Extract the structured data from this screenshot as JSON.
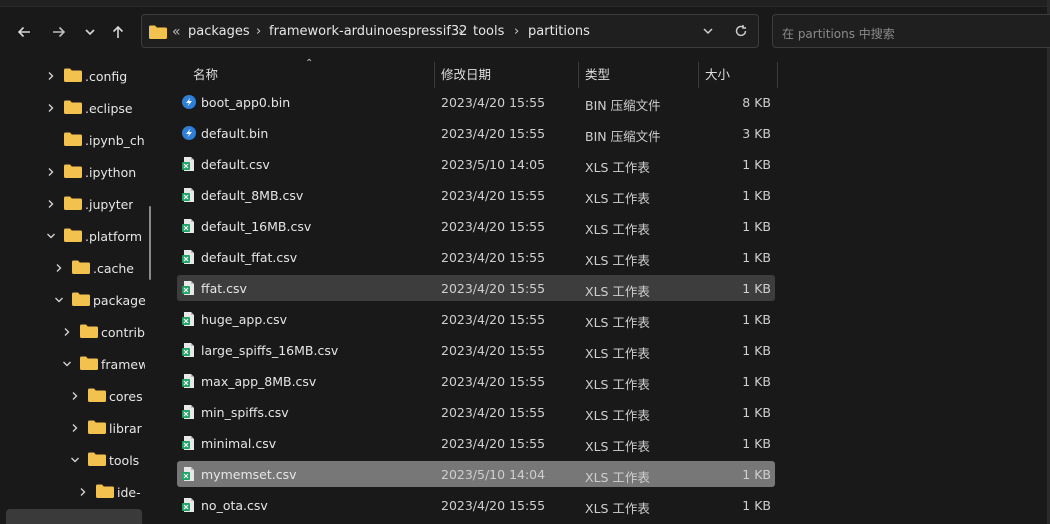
{
  "toolbar": {
    "back_icon": "arrow-left-icon",
    "forward_icon": "arrow-right-icon",
    "recent_icon": "chevron-down-icon",
    "up_icon": "arrow-up-icon"
  },
  "address": {
    "overflow": "«",
    "segments": [
      "packages",
      "framework-arduinoespressif32",
      "tools",
      "partitions"
    ]
  },
  "search": {
    "placeholder": "在 partitions 中搜索"
  },
  "tree": {
    "items": [
      {
        "label": ".config",
        "expanded": false,
        "has_children": true
      },
      {
        "label": ".eclipse",
        "expanded": false,
        "has_children": true
      },
      {
        "label": ".ipynb_ch",
        "expanded": false,
        "has_children": false
      },
      {
        "label": ".ipython",
        "expanded": false,
        "has_children": true
      },
      {
        "label": ".jupyter",
        "expanded": false,
        "has_children": true
      },
      {
        "label": ".platform",
        "expanded": true,
        "has_children": true
      },
      {
        "label": ".cache",
        "expanded": false,
        "has_children": true
      },
      {
        "label": "package",
        "expanded": true,
        "has_children": true
      },
      {
        "label": "contrib",
        "expanded": false,
        "has_children": true
      },
      {
        "label": "framew",
        "expanded": true,
        "has_children": true
      },
      {
        "label": "cores",
        "expanded": false,
        "has_children": true
      },
      {
        "label": "librar",
        "expanded": false,
        "has_children": true
      },
      {
        "label": "tools",
        "expanded": true,
        "has_children": true
      },
      {
        "label": "ide-",
        "expanded": false,
        "has_children": true
      }
    ]
  },
  "columns": {
    "name": "名称",
    "date": "修改日期",
    "type": "类型",
    "size": "大小"
  },
  "files": [
    {
      "name": "boot_app0.bin",
      "date": "2023/4/20 15:55",
      "type": "BIN 压缩文件",
      "size": "8 KB",
      "icon": "bin-file-icon",
      "state": ""
    },
    {
      "name": "default.bin",
      "date": "2023/4/20 15:55",
      "type": "BIN 压缩文件",
      "size": "3 KB",
      "icon": "bin-file-icon",
      "state": ""
    },
    {
      "name": "default.csv",
      "date": "2023/5/10 14:05",
      "type": "XLS 工作表",
      "size": "1 KB",
      "icon": "csv-file-icon",
      "state": ""
    },
    {
      "name": "default_8MB.csv",
      "date": "2023/4/20 15:55",
      "type": "XLS 工作表",
      "size": "1 KB",
      "icon": "csv-file-icon",
      "state": ""
    },
    {
      "name": "default_16MB.csv",
      "date": "2023/4/20 15:55",
      "type": "XLS 工作表",
      "size": "1 KB",
      "icon": "csv-file-icon",
      "state": ""
    },
    {
      "name": "default_ffat.csv",
      "date": "2023/4/20 15:55",
      "type": "XLS 工作表",
      "size": "1 KB",
      "icon": "csv-file-icon",
      "state": ""
    },
    {
      "name": "ffat.csv",
      "date": "2023/4/20 15:55",
      "type": "XLS 工作表",
      "size": "1 KB",
      "icon": "csv-file-icon",
      "state": "hover"
    },
    {
      "name": "huge_app.csv",
      "date": "2023/4/20 15:55",
      "type": "XLS 工作表",
      "size": "1 KB",
      "icon": "csv-file-icon",
      "state": ""
    },
    {
      "name": "large_spiffs_16MB.csv",
      "date": "2023/4/20 15:55",
      "type": "XLS 工作表",
      "size": "1 KB",
      "icon": "csv-file-icon",
      "state": ""
    },
    {
      "name": "max_app_8MB.csv",
      "date": "2023/4/20 15:55",
      "type": "XLS 工作表",
      "size": "1 KB",
      "icon": "csv-file-icon",
      "state": ""
    },
    {
      "name": "min_spiffs.csv",
      "date": "2023/4/20 15:55",
      "type": "XLS 工作表",
      "size": "1 KB",
      "icon": "csv-file-icon",
      "state": ""
    },
    {
      "name": "minimal.csv",
      "date": "2023/4/20 15:55",
      "type": "XLS 工作表",
      "size": "1 KB",
      "icon": "csv-file-icon",
      "state": ""
    },
    {
      "name": "mymemset.csv",
      "date": "2023/5/10 14:04",
      "type": "XLS 工作表",
      "size": "1 KB",
      "icon": "csv-file-icon",
      "state": "selected"
    },
    {
      "name": "no_ota.csv",
      "date": "2023/4/20 15:55",
      "type": "XLS 工作表",
      "size": "1 KB",
      "icon": "csv-file-icon",
      "state": ""
    }
  ],
  "colors": {
    "background": "#191919",
    "folder": "#f2c14e",
    "bin_icon": "#2f7fd6",
    "csv_icon": "#21a366",
    "hover_row": "#3d3d3d",
    "selected_row": "#777777"
  }
}
